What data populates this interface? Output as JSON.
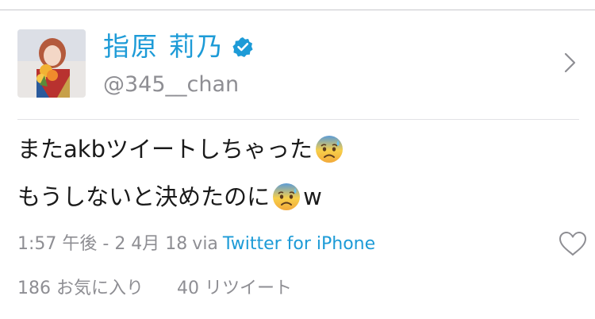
{
  "profile": {
    "display_name": "指原 莉乃",
    "handle": "@345__chan",
    "verified": true,
    "avatar": "profile-photo"
  },
  "tweet": {
    "lines": [
      {
        "text": "またakbツイートしちゃった",
        "emoji": "anxious-face-with-sweat-icon",
        "suffix": ""
      },
      {
        "text": "もうしないと決めたのに",
        "emoji": "anxious-face-with-sweat-icon",
        "suffix": "w"
      }
    ]
  },
  "meta": {
    "time": "1:57 午後 - 2 4月 18",
    "via": "via",
    "source": "Twitter for iPhone"
  },
  "stats": {
    "likes": "186 お気に入り",
    "retweets": "40 リツイート"
  },
  "colors": {
    "accent": "#1d9bd7",
    "muted": "#8e8e93",
    "text": "#1a1a1a",
    "divider": "#c8c8cc"
  },
  "icons": {
    "verified": "verified-badge-icon",
    "chevron": "chevron-right-icon",
    "like": "heart-outline-icon"
  }
}
